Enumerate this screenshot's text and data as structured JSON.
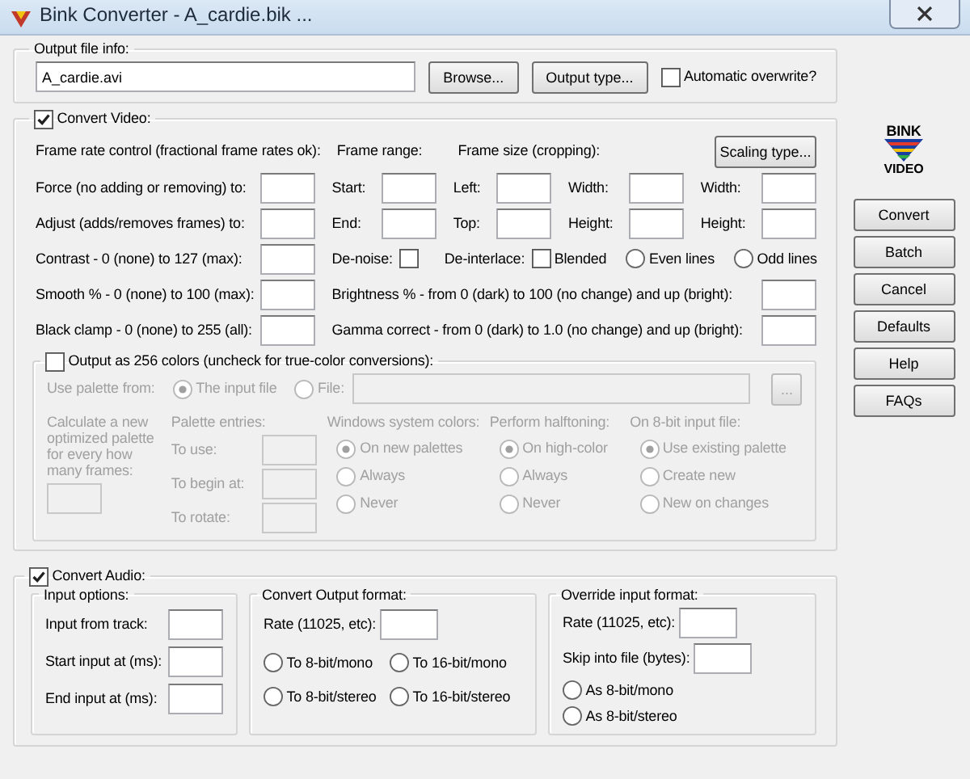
{
  "window": {
    "title": "Bink Converter - A_cardie.bik ..."
  },
  "output": {
    "legend": "Output file info:",
    "file": "A_cardie.avi",
    "browse": "Browse...",
    "output_type": "Output type...",
    "auto_overwrite": {
      "label": "Automatic overwrite?",
      "checked": false
    }
  },
  "video": {
    "label": "Convert Video:",
    "checked": true,
    "frame_rate": {
      "heading": "Frame rate control (fractional frame rates ok):",
      "force": "Force (no adding or removing) to:",
      "adjust": "Adjust (adds/removes frames) to:"
    },
    "frame_range": {
      "heading": "Frame range:",
      "start": "Start:",
      "end": "End:"
    },
    "frame_size": {
      "heading": "Frame size (cropping):",
      "left": "Left:",
      "width": "Width:",
      "top": "Top:",
      "height": "Height:"
    },
    "scaling": {
      "button": "Scaling type...",
      "width": "Width:",
      "height": "Height:"
    },
    "contrast": "Contrast - 0 (none) to 127 (max):",
    "denoise": {
      "label": "De-noise:",
      "checked": false
    },
    "deinterlace": {
      "label": "De-interlace:",
      "blended": {
        "label": "Blended",
        "checked": false
      },
      "options": [
        {
          "label": "Even lines",
          "selected": false
        },
        {
          "label": "Odd lines",
          "selected": false
        }
      ]
    },
    "smooth": "Smooth % - 0 (none) to 100 (max):",
    "brightness": "Brightness % - from 0 (dark) to 100 (no change) and up (bright):",
    "black_clamp": "Black clamp - 0 (none) to 255 (all):",
    "gamma": "Gamma correct - from 0 (dark) to 1.0 (no change) and up (bright):",
    "palette": {
      "label": "Output as 256 colors (uncheck for true-color conversions):",
      "checked": false,
      "disabled": true,
      "use_from": {
        "label": "Use palette from:",
        "options": [
          {
            "label": "The input file",
            "selected": true
          },
          {
            "label": "File:",
            "selected": false
          }
        ],
        "browse": "..."
      },
      "calculate": "Calculate a new optimized palette for every how many frames:",
      "entries": {
        "heading": "Palette entries:",
        "fields": [
          "To use:",
          "To begin at:",
          "To rotate:"
        ]
      },
      "groups": [
        {
          "heading": "Windows system colors:",
          "options": [
            {
              "label": "On new palettes",
              "selected": true
            },
            {
              "label": "Always",
              "selected": false
            },
            {
              "label": "Never",
              "selected": false
            }
          ]
        },
        {
          "heading": "Perform halftoning:",
          "options": [
            {
              "label": "On high-color",
              "selected": true
            },
            {
              "label": "Always",
              "selected": false
            },
            {
              "label": "Never",
              "selected": false
            }
          ]
        },
        {
          "heading": "On 8-bit input file:",
          "options": [
            {
              "label": "Use existing palette",
              "selected": true
            },
            {
              "label": "Create new",
              "selected": false
            },
            {
              "label": "New on changes",
              "selected": false
            }
          ]
        }
      ]
    }
  },
  "audio": {
    "label": "Convert Audio:",
    "checked": true,
    "input_options": {
      "legend": "Input options:",
      "fields": [
        "Input from track:",
        "Start input at (ms):",
        "End input at (ms):"
      ]
    },
    "output_format": {
      "legend": "Convert Output format:",
      "rate": "Rate (11025, etc):",
      "options": [
        {
          "label": "To 8-bit/mono",
          "selected": false
        },
        {
          "label": "To 16-bit/mono",
          "selected": false
        },
        {
          "label": "To 8-bit/stereo",
          "selected": false
        },
        {
          "label": "To 16-bit/stereo",
          "selected": false
        }
      ]
    },
    "override": {
      "legend": "Override input format:",
      "rate": "Rate (11025, etc):",
      "skip": "Skip into file (bytes):",
      "options": [
        {
          "label": "As 8-bit/mono",
          "selected": false
        },
        {
          "label": "As 8-bit/stereo",
          "selected": false
        }
      ]
    }
  },
  "logo": {
    "top": "BINK",
    "bottom": "VIDEO"
  },
  "buttons": [
    "Convert",
    "Batch",
    "Cancel",
    "Defaults",
    "Help",
    "FAQs"
  ]
}
